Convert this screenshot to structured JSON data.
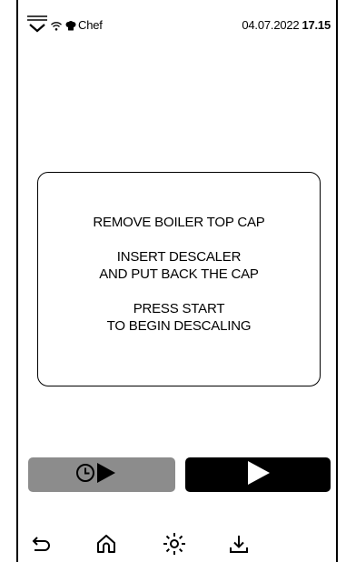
{
  "status_bar": {
    "user": "Chef",
    "date": "04.07.2022",
    "time": "17.15",
    "icons": [
      "menu-icon",
      "wifi-icon",
      "chef-hat-icon"
    ]
  },
  "message": {
    "line1": "REMOVE BOILER TOP CAP",
    "line2": "INSERT DESCALER",
    "line3": "AND PUT BACK THE CAP",
    "line4": "PRESS START",
    "line5": "TO BEGIN DESCALING"
  },
  "actions": {
    "delayed_start_icon": "clock-play-icon",
    "delayed_start_color": "#8c8c8c",
    "start_icon": "play-icon",
    "start_color": "#000000"
  },
  "nav": {
    "items": [
      "back-icon",
      "home-icon",
      "light-icon",
      "download-icon"
    ]
  }
}
